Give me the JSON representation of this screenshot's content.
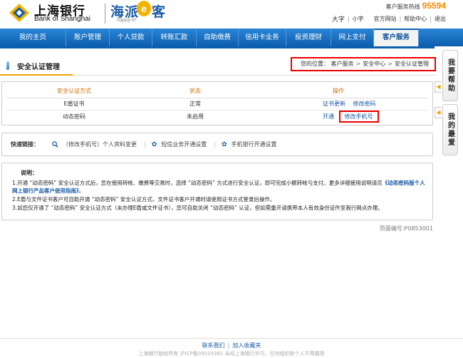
{
  "header": {
    "bank_name_cn": "上海银行",
    "bank_name_en": "Bank of Shanghai",
    "brand_cn": "海派",
    "brand_e": "e",
    "brand_cn2": "客",
    "brand_en": "happy-e!",
    "hotline_label": "客户服务热线",
    "hotline_number": "95594",
    "font_large": "大字",
    "font_small": "小字",
    "website": "官方网站",
    "help": "帮助中心",
    "logout": "退出"
  },
  "nav": {
    "items": [
      {
        "label": "我的主页",
        "width": 0
      },
      {
        "label": "账户管理"
      },
      {
        "label": "个人贷款"
      },
      {
        "label": "转账汇款"
      },
      {
        "label": "自助缴费"
      },
      {
        "label": "信用卡业务"
      },
      {
        "label": "投资理财"
      },
      {
        "label": "网上支付"
      },
      {
        "label": "客户服务"
      }
    ],
    "active_index": 8
  },
  "page": {
    "title": "安全认证管理",
    "breadcrumb_label": "您的位置：",
    "breadcrumb": [
      "客户服务",
      "安全中心",
      "安全认证管理"
    ]
  },
  "side": {
    "help": "我要帮助",
    "favorites": "我的最爱",
    "arrow": "◀"
  },
  "auth_table": {
    "headers": [
      "安全认证方式",
      "状态",
      "操作"
    ],
    "rows": [
      {
        "method": "E盾证书",
        "status": "正常",
        "ops": [
          "证书更新",
          "修改密码"
        ]
      },
      {
        "method": "动态密码",
        "status": "未启用",
        "ops": [
          "开通",
          "修改手机号"
        ]
      }
    ]
  },
  "quick_links": {
    "label": "快速链接：",
    "items": [
      "（修改手机号）个人资料变更",
      "短信业务开通设置",
      "手机银行开通设置"
    ]
  },
  "notes": {
    "title": "说明：",
    "line1": "1.开通 “动态密码” 安全认证方式后，您在使用转帐、缴费等交易时，选择 “动态密码” 方式进行安全认证，即可完成小额转帐与支付。更多详细使用说明请见",
    "line1_link": "《动态密码版个人网上银行产品客户使用指南》",
    "line1_end": "。",
    "line2": "2.E盾与文件证书客户可自助开通 “动态密码” 安全认证方式，文件证书客户开通时请使用证书方式登录后操作。",
    "line3": "3.如您仅开通了 “动态密码” 安全认证方式（未办理E盾或文件证书），您可自助关闭 “动态密码” 认证，但如需重开请携带本人有效身份证件至我行网点办理。"
  },
  "page_number": "页面编号:P0853001",
  "footer": {
    "contact": "联系我们",
    "favorite": "加入收藏夹",
    "copyright": "上海银行版权所有 沪ICP备05019381 未经上海银行许可，任何组织和个人不得擅用"
  },
  "colors": {
    "nav_blue": "#0d5fae",
    "accent_orange": "#f5a300",
    "highlight_red": "#e00000",
    "link_blue": "#1a5aa6"
  }
}
